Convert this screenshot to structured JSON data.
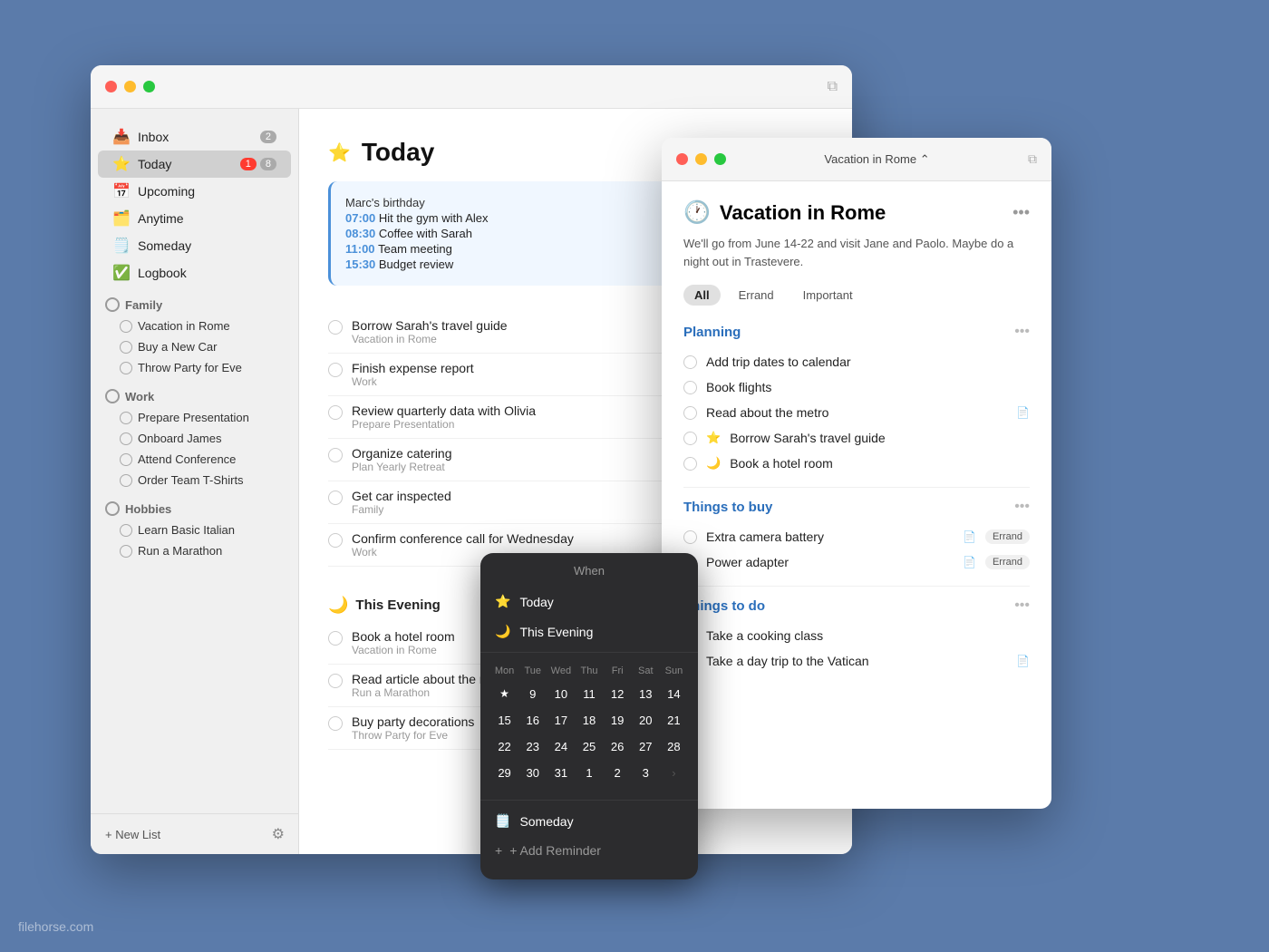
{
  "app": {
    "title": "Today",
    "star": "⭐",
    "copy_icon": "⧉"
  },
  "traffic_lights": {
    "red": "close",
    "yellow": "minimize",
    "green": "maximize"
  },
  "sidebar": {
    "inbox_label": "Inbox",
    "inbox_count": "2",
    "today_label": "Today",
    "today_badge_red": "1",
    "today_badge_gray": "8",
    "upcoming_label": "Upcoming",
    "anytime_label": "Anytime",
    "someday_label": "Someday",
    "logbook_label": "Logbook",
    "family_header": "Family",
    "family_items": [
      {
        "label": "Vacation in Rome"
      },
      {
        "label": "Buy a New Car"
      },
      {
        "label": "Throw Party for Eve"
      }
    ],
    "work_header": "Work",
    "work_items": [
      {
        "label": "Prepare Presentation"
      },
      {
        "label": "Onboard James"
      },
      {
        "label": "Attend Conference"
      },
      {
        "label": "Order Team T-Shirts"
      }
    ],
    "hobbies_header": "Hobbies",
    "hobbies_items": [
      {
        "label": "Learn Basic Italian"
      },
      {
        "label": "Run a Marathon"
      }
    ],
    "new_list_label": "+ New List"
  },
  "today_view": {
    "title": "Today",
    "events": [
      {
        "time": "",
        "name": "Marc's birthday"
      },
      {
        "time": "07:00",
        "name": "Hit the gym with Alex"
      },
      {
        "time": "08:30",
        "name": "Coffee with Sarah"
      },
      {
        "time": "11:00",
        "name": "Team meeting"
      },
      {
        "time": "15:30",
        "name": "Budget review"
      }
    ],
    "tasks": [
      {
        "name": "Borrow Sarah's travel guide",
        "sub": "Vacation in Rome"
      },
      {
        "name": "Finish expense report",
        "sub": "Work"
      },
      {
        "name": "Review quarterly data with Olivia",
        "sub": "Prepare Presentation"
      },
      {
        "name": "Organize catering",
        "sub": "Plan Yearly Retreat"
      },
      {
        "name": "Get car inspected",
        "sub": "Family"
      },
      {
        "name": "Confirm conference call for Wednesday",
        "sub": "Work"
      }
    ],
    "this_evening_label": "This Evening",
    "this_evening_tasks": [
      {
        "name": "Book a hotel room",
        "sub": "Vacation in Rome"
      },
      {
        "name": "Read article about the metro",
        "sub": "Run a Marathon"
      },
      {
        "name": "Buy party decorations",
        "sub": "Throw Party for Eve"
      }
    ]
  },
  "when_popup": {
    "title": "When",
    "today_label": "Today",
    "this_evening_label": "This Evening",
    "cal_days": [
      "Mon",
      "Tue",
      "Wed",
      "Thu",
      "Fri",
      "Sat",
      "Sun"
    ],
    "cal_rows": [
      [
        "★",
        "9",
        "10",
        "11",
        "12",
        "13",
        "14"
      ],
      [
        "15",
        "16",
        "17",
        "18",
        "19",
        "20",
        "21"
      ],
      [
        "22",
        "23",
        "24",
        "25",
        "26",
        "27",
        "28"
      ],
      [
        "29",
        "30",
        "31",
        "1",
        "2",
        "3",
        ">"
      ]
    ],
    "someday_label": "Someday",
    "add_reminder_label": "+ Add Reminder"
  },
  "rome_panel": {
    "title": "Vacation in Rome",
    "chevron": "⌃",
    "copy_icon": "⧉",
    "icon": "🕐",
    "main_title": "Vacation in Rome",
    "dots": "•••",
    "description": "We'll go from June 14-22 and visit Jane and Paolo. Maybe do a night out in Trastevere.",
    "tags": [
      {
        "label": "All",
        "active": true
      },
      {
        "label": "Errand",
        "active": false
      },
      {
        "label": "Important",
        "active": false
      }
    ],
    "sections": [
      {
        "title": "Planning",
        "tasks": [
          {
            "name": "Add trip dates to calendar",
            "icon": "",
            "badge": ""
          },
          {
            "name": "Book flights",
            "icon": "",
            "badge": ""
          },
          {
            "name": "Read about the metro",
            "icon": "📄",
            "badge": ""
          },
          {
            "name": "Borrow Sarah's travel guide",
            "star": true,
            "icon": "",
            "badge": ""
          },
          {
            "name": "Book a hotel room",
            "moon": true,
            "icon": "",
            "badge": ""
          }
        ]
      },
      {
        "title": "Things to buy",
        "tasks": [
          {
            "name": "Extra camera battery",
            "icon": "📄",
            "badge": "Errand"
          },
          {
            "name": "Power adapter",
            "icon": "📄",
            "badge": "Errand"
          }
        ]
      },
      {
        "title": "Things to do",
        "tasks": [
          {
            "name": "Take a cooking class",
            "icon": "",
            "badge": ""
          },
          {
            "name": "Take a day trip to the Vatican",
            "icon": "📄",
            "badge": ""
          }
        ]
      }
    ]
  },
  "watermark": "filehorse.com"
}
